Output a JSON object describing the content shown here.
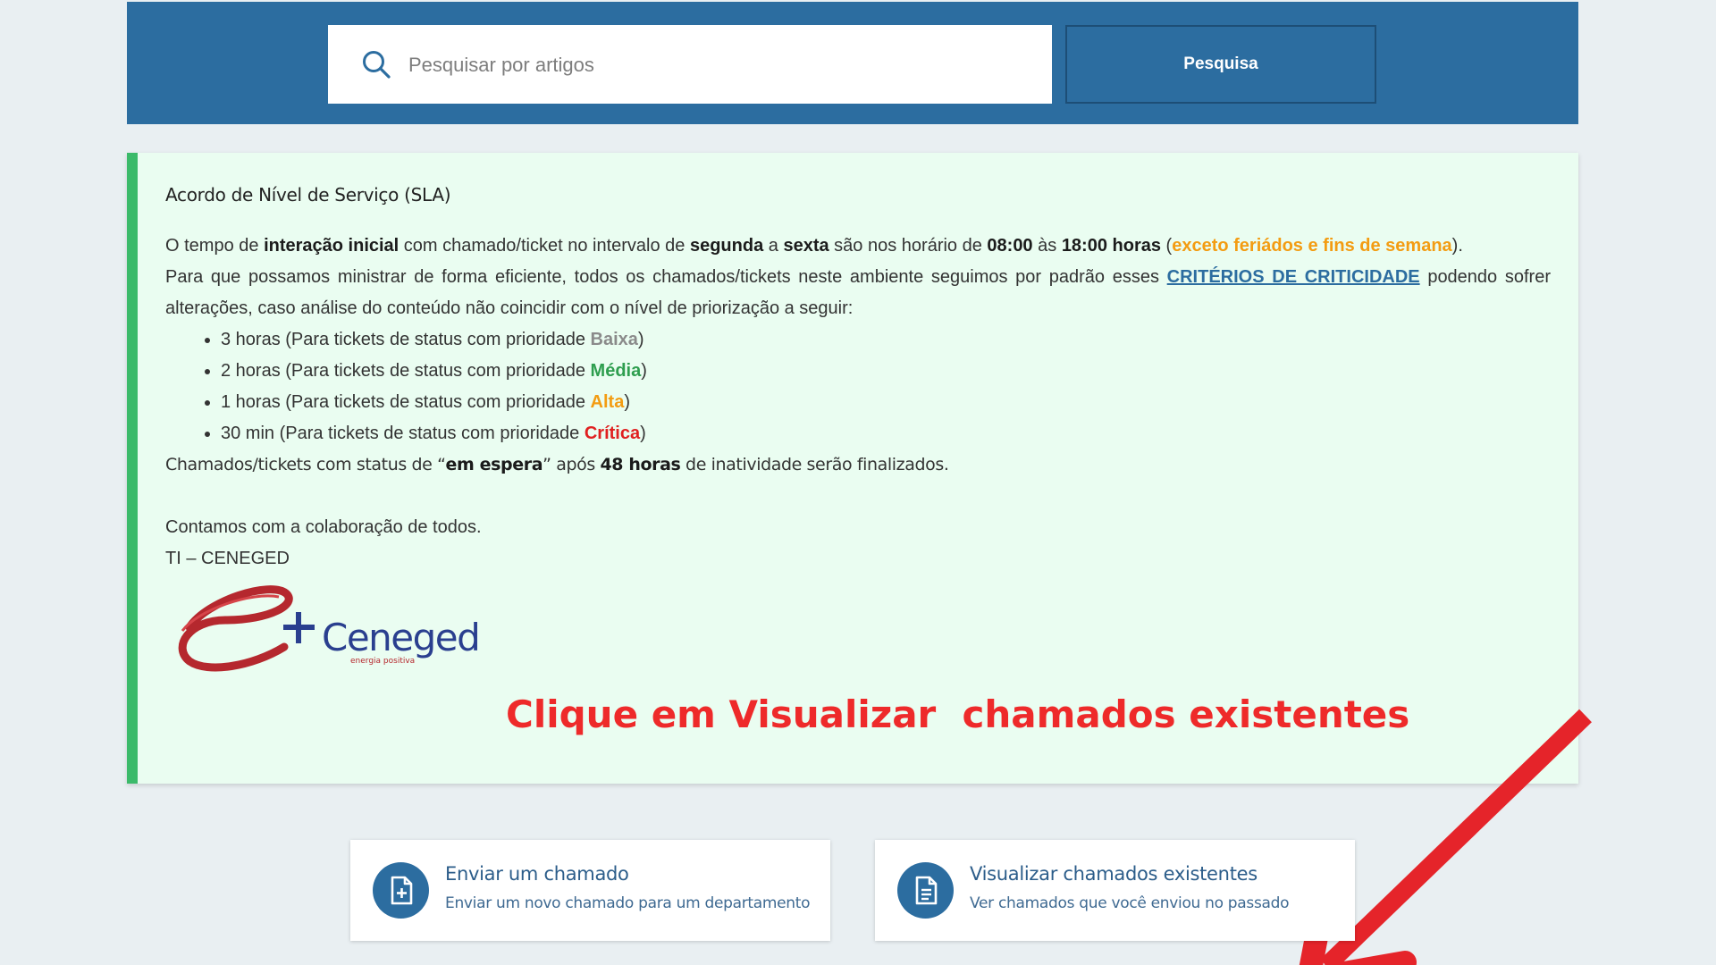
{
  "search": {
    "placeholder": "Pesquisar por artigos",
    "button_label": "Pesquisa"
  },
  "sla": {
    "title": "Acordo de Nível de Serviço (SLA)",
    "para1": {
      "t1": "O tempo de ",
      "b1": "interação inicial",
      "t2": " com chamado/ticket no intervalo de ",
      "b2": "segunda",
      "t3": " a ",
      "b3": "sexta",
      "t4": " são nos horário de ",
      "b4": "08:00",
      "t5": " às ",
      "b5": "18:00 horas",
      "t6": " (",
      "orange": "exceto feriádos e fins de semana",
      "t7": ")."
    },
    "para2": {
      "t1": "Para que possamos ministrar de forma eficiente, todos os chamados/tickets neste ambiente seguimos por padrão esses ",
      "link": "CRITÉRIOS DE CRITICIDADE",
      "t2": " podendo sofrer alterações, caso análise do conteúdo não coincidir com o nível de priorização a seguir:"
    },
    "priorities": [
      {
        "prefix": "3 horas (Para tickets de status com prioridade ",
        "level": "Baixa",
        "suffix": ")"
      },
      {
        "prefix": "2 horas (Para tickets de status com prioridade ",
        "level": "Média",
        "suffix": ")"
      },
      {
        "prefix": "1 horas (Para tickets de status com prioridade ",
        "level": "Alta",
        "suffix": ")"
      },
      {
        "prefix": "30 min (Para tickets de status com prioridade ",
        "level": "Crítica",
        "suffix": ")"
      }
    ],
    "para3": {
      "t1": "Chamados/tickets com status de “",
      "b1": "em espera",
      "t2": "” após ",
      "b2": "48 horas",
      "t3": " de inatividade serão finalizados."
    },
    "closing": "Contamos com a colaboração de todos.",
    "signature": "TI – CENEGED",
    "logo_text": "Ceneged",
    "logo_tagline": "energia positiva"
  },
  "callout": "Clique em Visualizar  chamados existentes",
  "cards": [
    {
      "title": "Enviar um chamado",
      "subtitle": "Enviar um novo chamado para um departamento",
      "icon": "document-plus-icon"
    },
    {
      "title": "Visualizar chamados existentes",
      "subtitle": "Ver chamados que você enviou no passado",
      "icon": "document-list-icon"
    }
  ],
  "colors": {
    "banner": "#2c6da0",
    "panel_bg": "#eafdf1",
    "panel_accent": "#3bba6a",
    "callout": "#ee2a2a",
    "priority_low": "#8a8a8a",
    "priority_medium": "#2e9e4f",
    "priority_high": "#f39c12",
    "priority_critical": "#e02020"
  }
}
